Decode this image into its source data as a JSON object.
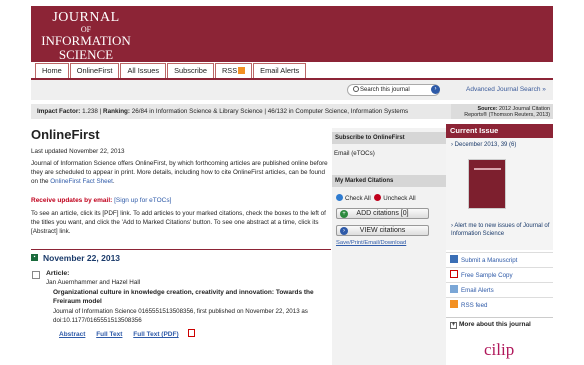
{
  "journal": {
    "logo_line1": "JOURNAL",
    "logo_line2": "OF",
    "logo_line3": "INFORMATION",
    "logo_line4": "SCIENCE"
  },
  "nav": {
    "tabs": [
      "Home",
      "OnlineFirst",
      "All Issues",
      "Subscribe",
      "RSS",
      "Email Alerts"
    ]
  },
  "search": {
    "placeholder": "Search this journal",
    "advanced": "Advanced Journal Search »"
  },
  "impact": {
    "factor_label": "Impact Factor:",
    "factor_value": "1.238",
    "ranking_label": "Ranking:",
    "ranking_text": "26/84 in Information Science & Library Science | 46/132 in Computer Science, Information Systems",
    "source_label": "Source:",
    "source_text": "2012 Journal Citation Reports® (Thomson Reuters, 2013)"
  },
  "main": {
    "title": "OnlineFirst",
    "updated": "Last updated November 22, 2013",
    "intro": "Journal of Information Science offers OnlineFirst, by which forthcoming articles are published online before they are scheduled to appear in print. More details, including how to cite OnlineFirst articles, can be found on the",
    "fact_sheet_link": "OnlineFirst Fact Sheet",
    "receive_label": "Receive updates by email:",
    "receive_link": "[Sign up for eTOCs]",
    "instructions": "To see an article, click its [PDF] link. To add articles to your marked citations, check the boxes to the left of the titles you want, and click the 'Add to Marked Citations' button. To see one abstract at a time, click its [Abstract] link.",
    "date": "November 22, 2013",
    "article": {
      "label": "Article:",
      "authors": "Jan Auernhammer and Hazel Hall",
      "title": "Organizational culture in knowledge creation, creativity and innovation: Towards the Freiraum model",
      "citation": "Journal of Information Science 0165551513508356, first published on November 22, 2013 as doi:10.1177/0165551513508356",
      "links": [
        "Abstract",
        "Full Text",
        "Full Text (PDF)"
      ]
    }
  },
  "middle": {
    "subscribe_header": "Subscribe to OnlineFirst",
    "email_link": "Email (eTOCs)",
    "marked_header": "My Marked Citations",
    "check_all": "Check All",
    "uncheck_all": "Uncheck All",
    "add_button": "ADD citations [0]",
    "view_button": "VIEW citations",
    "save_link": "Save/Print/Email/Download"
  },
  "right": {
    "current_issue_header": "Current Issue",
    "issue": "December 2013, 39 (6)",
    "alert": "Alert me to new issues of Journal of Information Science",
    "links": [
      "Submit a Manuscript",
      "Free Sample Copy",
      "Email Alerts",
      "RSS feed"
    ],
    "more": "More about this journal",
    "partner_logo": "cilip"
  },
  "colors": {
    "brand": "#8c2436",
    "link": "#2e5aa8",
    "alert_red": "#c0001c"
  }
}
